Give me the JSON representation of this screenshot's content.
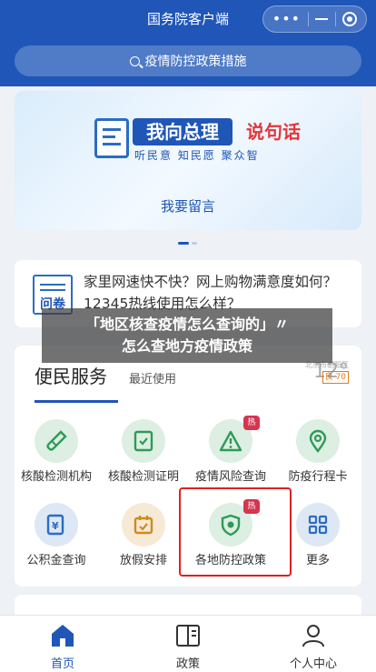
{
  "header": {
    "title": "国务院客户端"
  },
  "capsule": {
    "more": "•••"
  },
  "search": {
    "placeholder": "疫情防控政策措施"
  },
  "banner": {
    "headline_left": "我向总理",
    "headline_right": "说句话",
    "subtitle": "听民意 知民愿 聚众智",
    "cta": "我要留言"
  },
  "news": {
    "icon_label": "问卷",
    "text": "家里网速快不快？网上购物满意度如何？12345热线使用怎么样？"
  },
  "overlay": {
    "line1": "「地区核查疫情怎么查询的」〃",
    "line2": "怎么查地方疫情政策"
  },
  "services": {
    "title": "便民服务",
    "tab_recent": "最近使用",
    "weather_temp": "12°",
    "weather_location": "北京市朝阳区",
    "weather_air": "良 70",
    "items": [
      {
        "label": "核酸检测机构",
        "icon": "test-tube-icon",
        "hot": ""
      },
      {
        "label": "核酸检测证明",
        "icon": "certificate-icon",
        "hot": ""
      },
      {
        "label": "疫情风险查询",
        "icon": "warning-icon",
        "hot": "热"
      },
      {
        "label": "防疫行程卡",
        "icon": "location-pin-icon",
        "hot": ""
      },
      {
        "label": "公积金查询",
        "icon": "fund-document-icon",
        "hot": ""
      },
      {
        "label": "放假安排",
        "icon": "calendar-icon",
        "hot": ""
      },
      {
        "label": "各地防控政策",
        "icon": "shield-icon",
        "hot": "热"
      },
      {
        "label": "更多",
        "icon": "grid-more-icon",
        "hot": ""
      }
    ]
  },
  "tabbar": {
    "home": "首页",
    "policy": "政策",
    "profile": "个人中心"
  },
  "colors": {
    "brand_blue": "#1f56b8",
    "green_icon": "#2e9a57",
    "hot_badge": "#d6344f",
    "highlight_red": "#e02020"
  }
}
